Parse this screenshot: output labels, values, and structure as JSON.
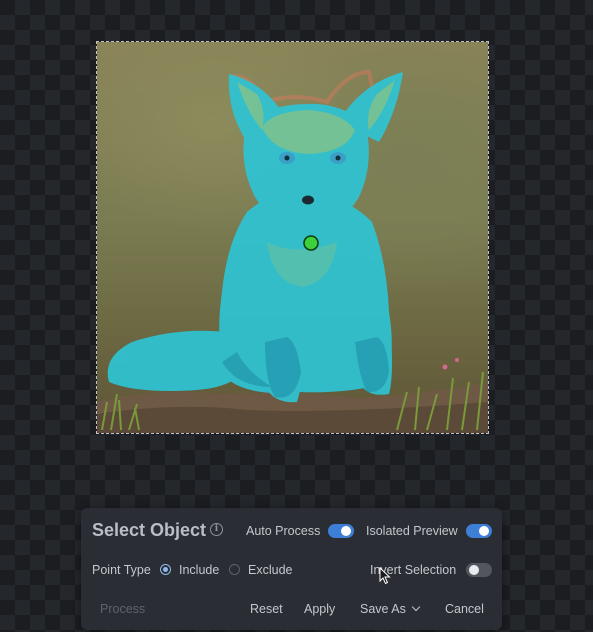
{
  "canvas": {
    "image": "fox-kit-sitting-photo",
    "mask_color": "#2ec4d4",
    "point_marker_color": "#3ad13a"
  },
  "panel": {
    "title": "Select Object",
    "info_icon": "info-icon",
    "auto_process": {
      "label": "Auto Process",
      "on": true
    },
    "isolated_preview": {
      "label": "Isolated Preview",
      "on": true
    },
    "point_type": {
      "label": "Point Type",
      "options": [
        {
          "label": "Include",
          "selected": true
        },
        {
          "label": "Exclude",
          "selected": false
        }
      ]
    },
    "invert_selection": {
      "label": "Invert Selection",
      "on": false
    },
    "actions": {
      "process": "Process",
      "reset": "Reset",
      "apply": "Apply",
      "save_as": "Save As",
      "cancel": "Cancel"
    }
  },
  "colors": {
    "accent": "#3d7fd6",
    "panel_bg": "#2a2d33"
  }
}
